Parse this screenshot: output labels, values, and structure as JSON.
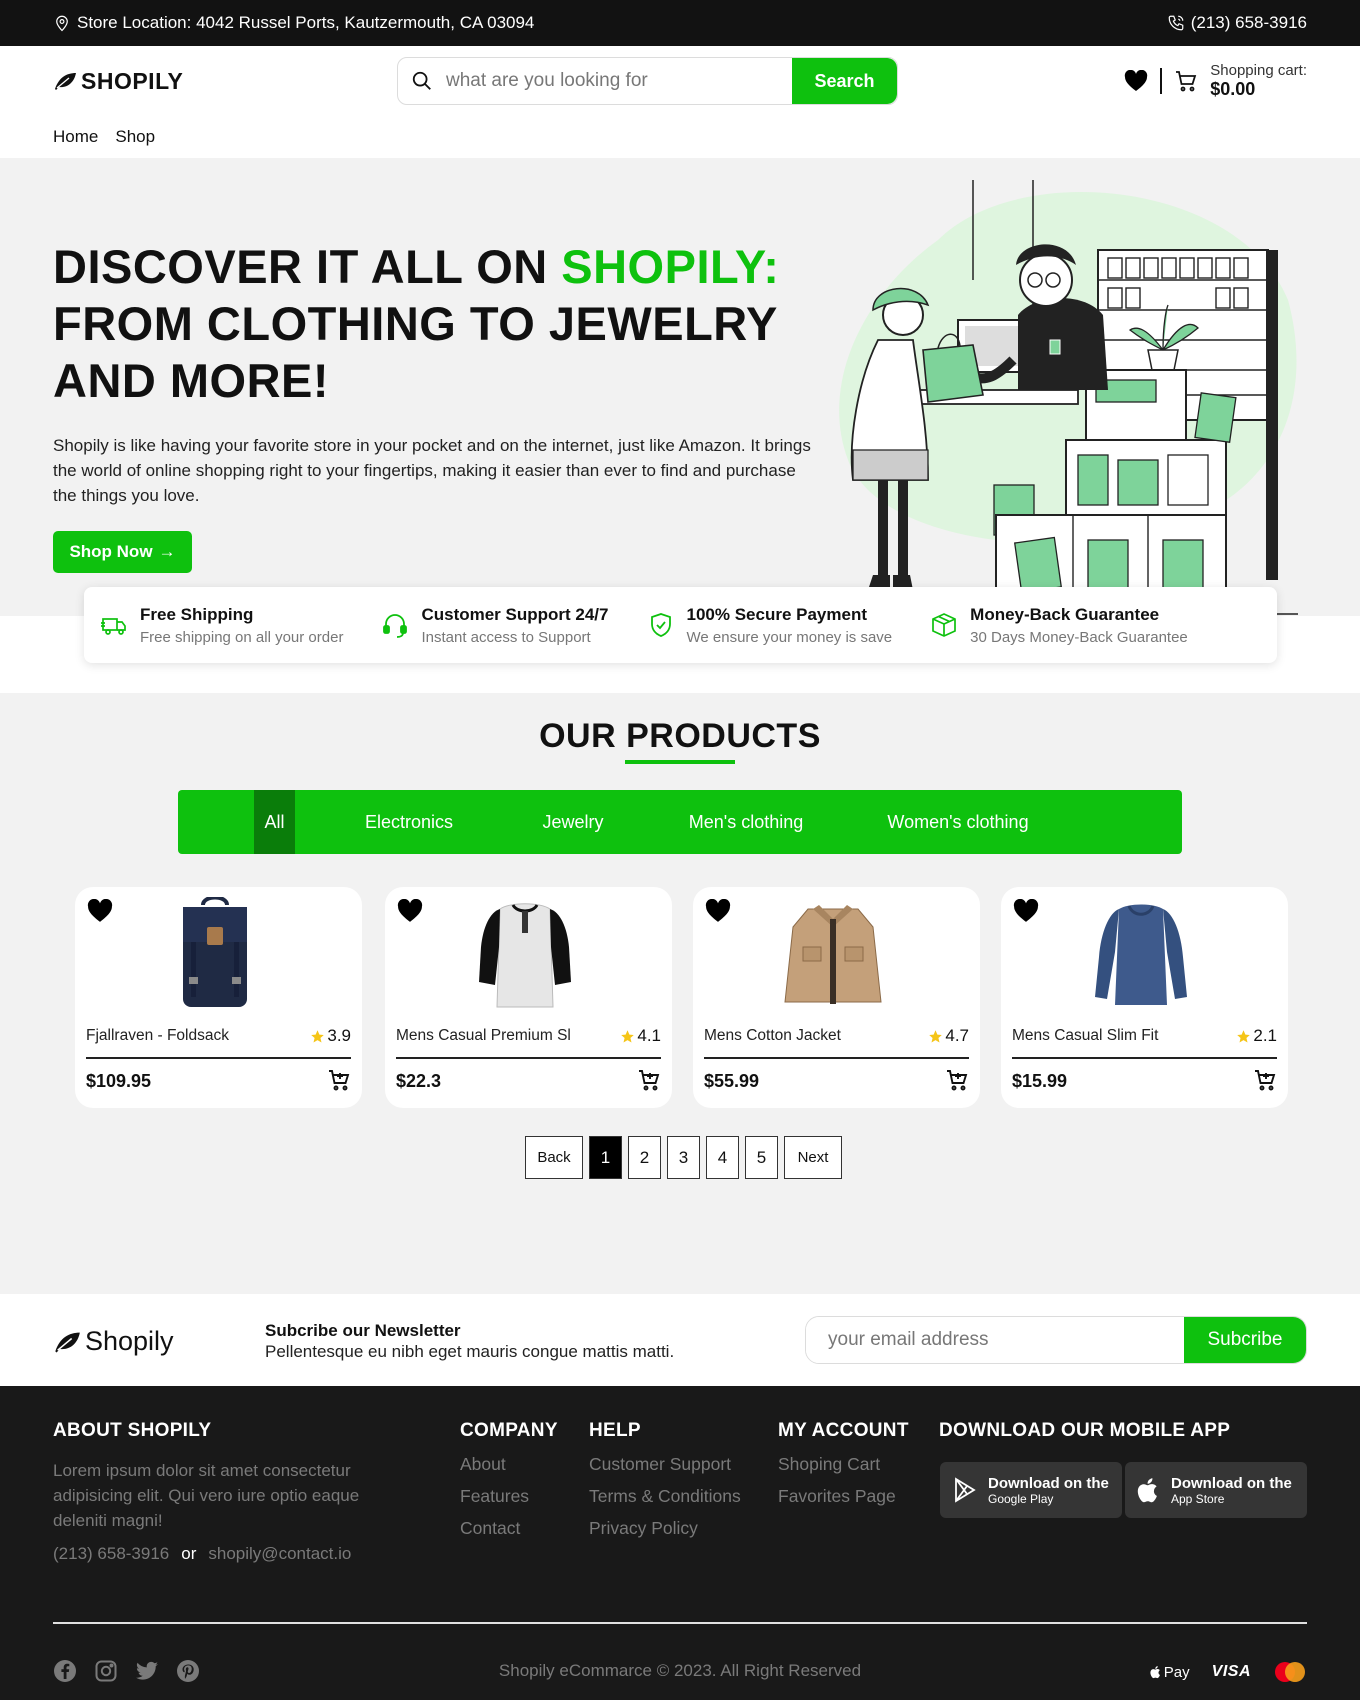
{
  "topbar": {
    "location": "Store Location: 4042 Russel Ports, Kautzermouth, CA 03094",
    "phone": "(213) 658-3916"
  },
  "header": {
    "logo": "SHOPILY",
    "search_placeholder": "what are you looking for",
    "search_button": "Search",
    "cart_label": "Shopping cart:",
    "cart_total": "$0.00"
  },
  "nav": [
    "Home",
    "Shop"
  ],
  "hero": {
    "title_part1": "DISCOVER IT ALL ON ",
    "title_highlight": "SHOPILY:",
    "title_part2": "FROM CLOTHING TO JEWELRY AND MORE!",
    "description": "Shopily is like having your favorite store in your pocket and on the internet, just like Amazon. It brings the world of online shopping right to your fingertips, making it easier than ever to find and purchase the things you love.",
    "cta": "Shop Now"
  },
  "features": [
    {
      "title": "Free Shipping",
      "subtitle": "Free shipping on all your order",
      "icon": "truck-icon"
    },
    {
      "title": "Customer Support 24/7",
      "subtitle": "Instant access to Support",
      "icon": "headset-icon"
    },
    {
      "title": "100% Secure Payment",
      "subtitle": "We ensure your money is save",
      "icon": "shield-check-icon"
    },
    {
      "title": "Money-Back Guarantee",
      "subtitle": "30 Days Money-Back Guarantee",
      "icon": "box-icon"
    }
  ],
  "products_section": {
    "title": "OUR PRODUCTS",
    "tabs": [
      "All",
      "Electronics",
      "Jewelry",
      "Men's clothing",
      "Women's clothing"
    ],
    "active_tab": "All",
    "items": [
      {
        "name": "Fjallraven - Foldsack",
        "rating": "3.9",
        "price": "$109.95",
        "image": "backpack"
      },
      {
        "name": "Mens Casual Premium Sl",
        "rating": "4.1",
        "price": "$22.3",
        "image": "raglan-shirt"
      },
      {
        "name": "Mens Cotton Jacket",
        "rating": "4.7",
        "price": "$55.99",
        "image": "jacket"
      },
      {
        "name": "Mens Casual Slim Fit",
        "rating": "2.1",
        "price": "$15.99",
        "image": "long-sleeve"
      }
    ],
    "pagination": {
      "back": "Back",
      "pages": [
        "1",
        "2",
        "3",
        "4",
        "5"
      ],
      "current": "1",
      "next": "Next"
    }
  },
  "newsletter": {
    "logo": "Shopily",
    "title": "Subcribe our Newsletter",
    "subtitle": "Pellentesque eu nibh eget mauris congue mattis matti.",
    "placeholder": "your email address",
    "button": "Subcribe"
  },
  "footer": {
    "about_title": "ABOUT SHOPILY",
    "about_text": "Lorem ipsum dolor sit amet consectetur adipisicing elit. Qui vero iure optio eaque deleniti magni!",
    "phone": "(213) 658-3916",
    "or": "or",
    "email": "shopily@contact.io",
    "company_title": "COMPANY",
    "company_links": [
      "About",
      "Features",
      "Contact"
    ],
    "help_title": "HELP",
    "help_links": [
      "Customer Support",
      "Terms & Conditions",
      "Privacy Policy"
    ],
    "account_title": "MY ACCOUNT",
    "account_links": [
      "Shoping Cart",
      "Favorites Page"
    ],
    "app_title": "DOWNLOAD OUR MOBILE APP",
    "google_play": {
      "line1": "Download on the",
      "line2": "Google Play"
    },
    "app_store": {
      "line1": "Download on the",
      "line2": "App Store"
    },
    "copyright": "Shopily eCommarce © 2023. All Right Reserved",
    "payments": {
      "applepay": "Pay",
      "visa": "VISA"
    }
  },
  "colors": {
    "accent": "#0ec10e",
    "accent_dark": "#0a7d0a",
    "dark": "#121212",
    "footer_bg": "#191919"
  }
}
